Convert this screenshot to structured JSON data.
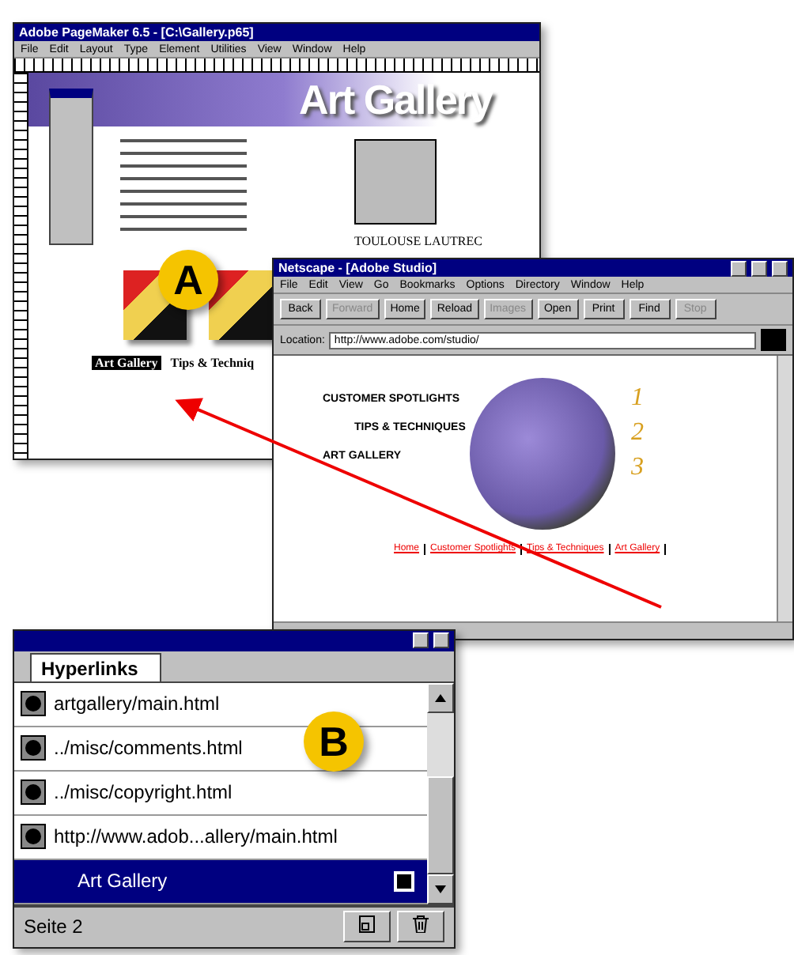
{
  "pagemaker": {
    "title": "Adobe PageMaker 6.5 - [C:\\Gallery.p65]",
    "menus": [
      "File",
      "Edit",
      "Layout",
      "Type",
      "Element",
      "Utilities",
      "View",
      "Window",
      "Help"
    ],
    "banner_title": "Art Gallery",
    "caption": "TOULOUSE LAUTREC",
    "links": [
      {
        "label": "Art Gallery",
        "selected": true
      },
      {
        "label": "Tips & Techniq",
        "selected": false
      }
    ]
  },
  "netscape": {
    "title": "Netscape - [Adobe Studio]",
    "menus": [
      "File",
      "Edit",
      "View",
      "Go",
      "Bookmarks",
      "Options",
      "Directory",
      "Window",
      "Help"
    ],
    "buttons": [
      {
        "label": "Back",
        "disabled": false
      },
      {
        "label": "Forward",
        "disabled": true
      },
      {
        "label": "Home",
        "disabled": false
      },
      {
        "label": "Reload",
        "disabled": false
      },
      {
        "label": "Images",
        "disabled": true
      },
      {
        "label": "Open",
        "disabled": false
      },
      {
        "label": "Print",
        "disabled": false
      },
      {
        "label": "Find",
        "disabled": false
      },
      {
        "label": "Stop",
        "disabled": true
      }
    ],
    "location_label": "Location:",
    "location": "http://www.adobe.com/studio/",
    "sections": [
      "CUSTOMER SPOTLIGHTS",
      "TIPS & TECHNIQUES",
      "ART GALLERY"
    ],
    "numbers": [
      "1",
      "2",
      "3"
    ],
    "footer_links": [
      "Home",
      "Customer Spotlights",
      "Tips & Techniques",
      "Art Gallery"
    ]
  },
  "hyperlinks": {
    "tab": "Hyperlinks",
    "items": [
      {
        "label": "artgallery/main.html",
        "kind": "url",
        "selected": false
      },
      {
        "label": "../misc/comments.html",
        "kind": "url",
        "selected": false
      },
      {
        "label": "../misc/copyright.html",
        "kind": "url",
        "selected": false
      },
      {
        "label": "http://www.adob...allery/main.html",
        "kind": "url",
        "selected": false
      },
      {
        "label": "Art Gallery",
        "kind": "anchor",
        "selected": true
      }
    ],
    "page": "Seite 2"
  },
  "callouts": [
    "A",
    "B"
  ]
}
